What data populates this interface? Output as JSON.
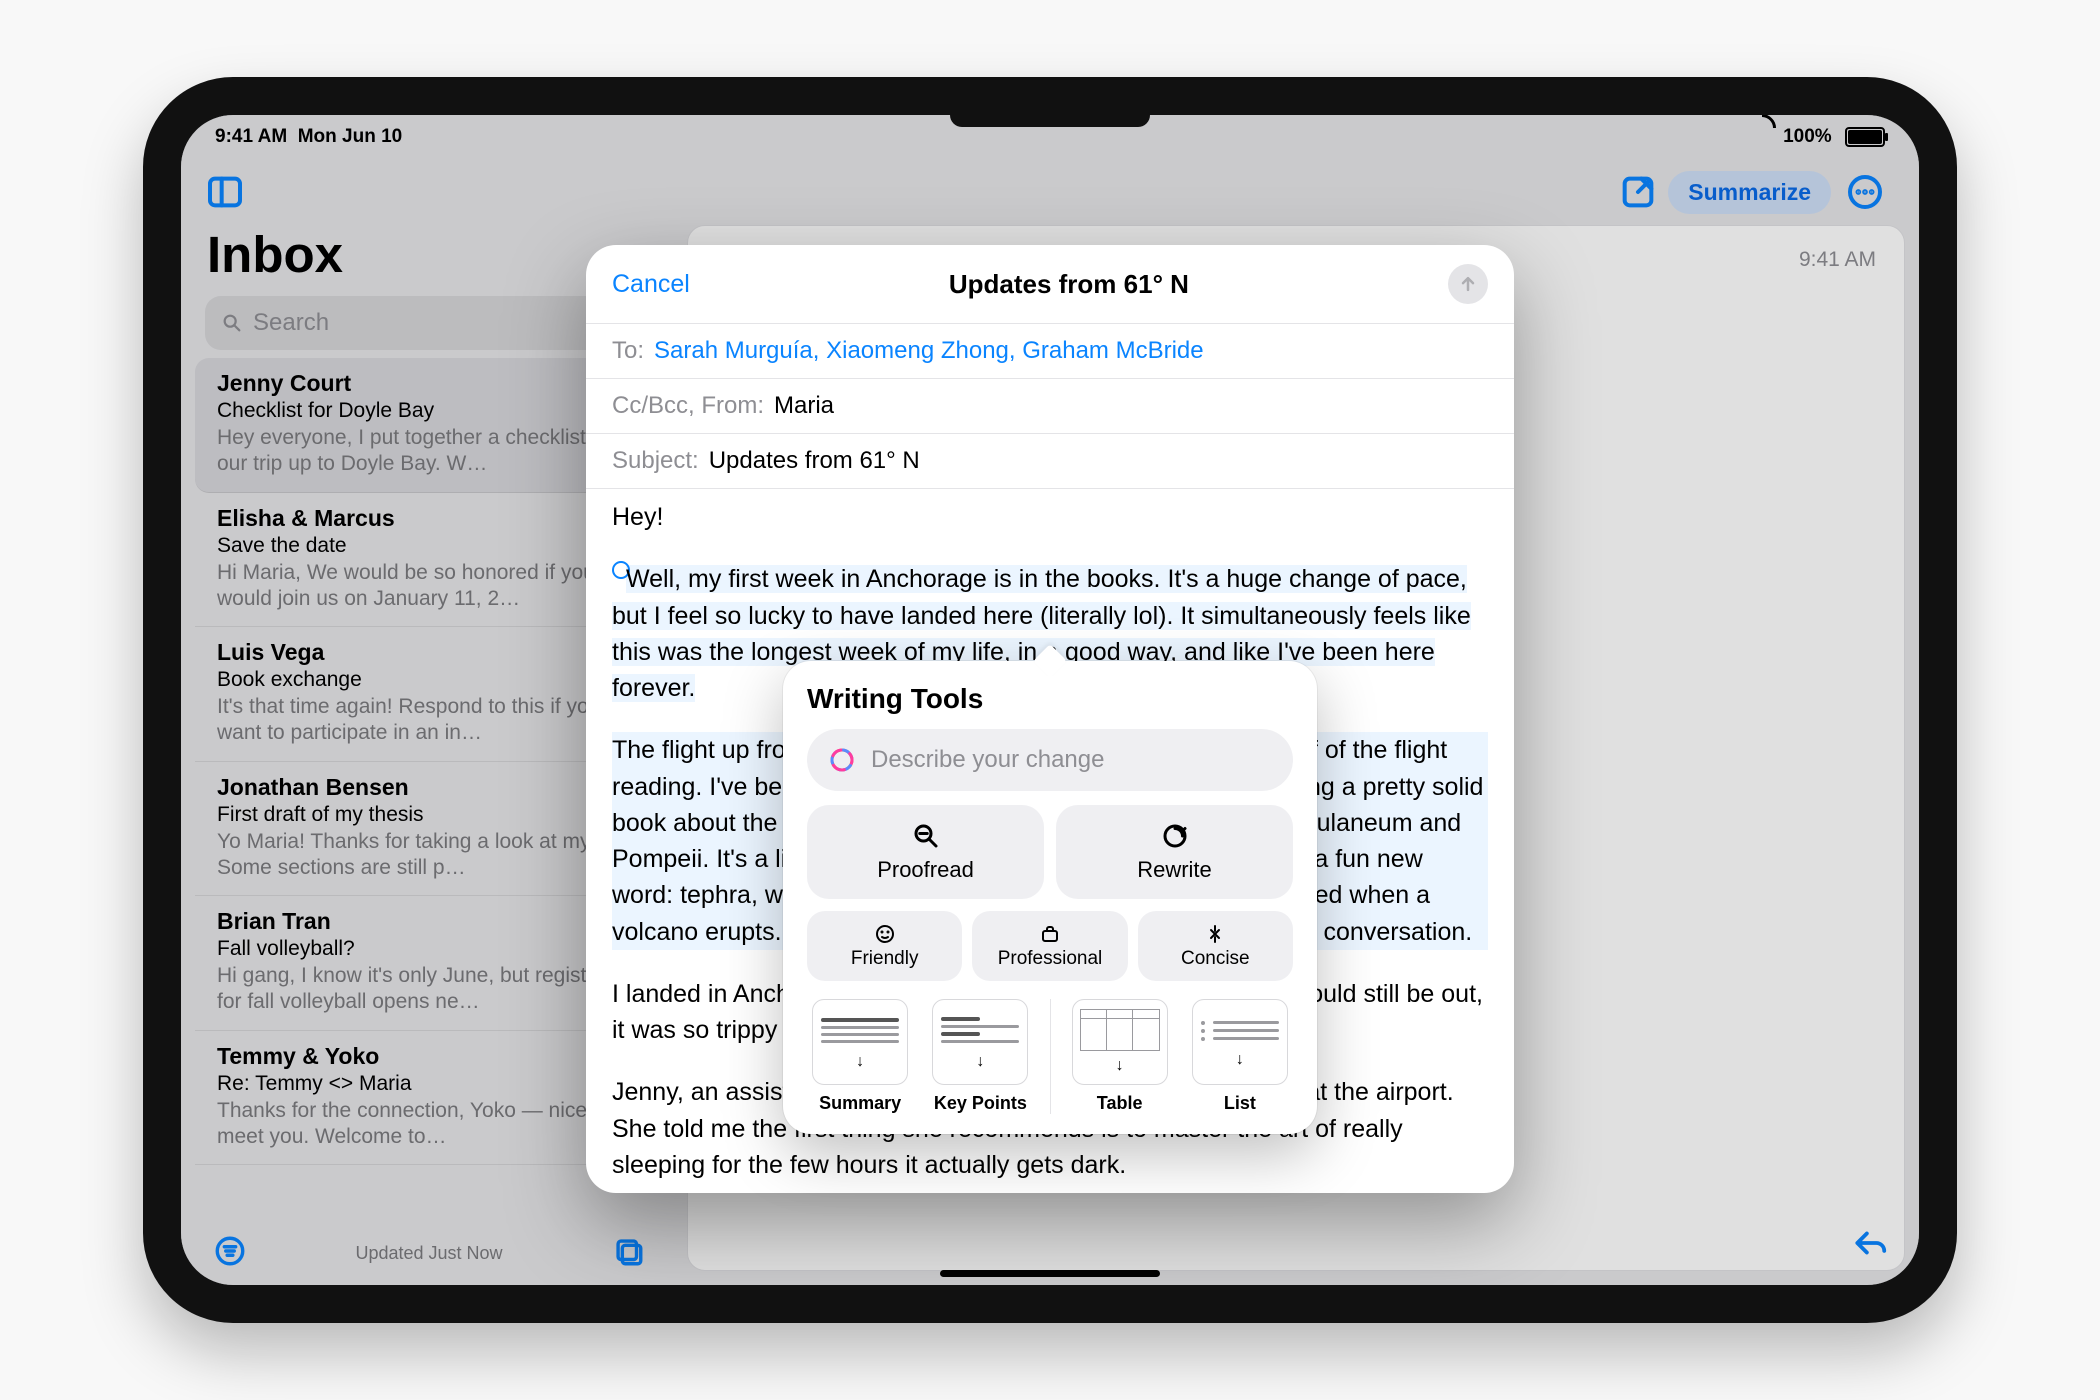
{
  "status": {
    "time": "9:41 AM",
    "date": "Mon Jun 10",
    "battery": "100%"
  },
  "toolbar": {
    "summarize": "Summarize"
  },
  "sidebar": {
    "title": "Inbox",
    "search_placeholder": "Search",
    "updated": "Updated Just Now",
    "items": [
      {
        "name": "Jenny Court",
        "subject": "Checklist for Doyle Bay",
        "preview": "Hey everyone, I put together a checklist for our trip up to Doyle Bay. W…"
      },
      {
        "name": "Elisha & Marcus",
        "subject": "Save the date",
        "preview": "Hi Maria, We would be so honored if you would join us on January 11, 2…"
      },
      {
        "name": "Luis Vega",
        "subject": "Book exchange",
        "preview": "It's that time again! Respond to this if you want to participate in an in…"
      },
      {
        "name": "Jonathan Bensen",
        "subject": "First draft of my thesis",
        "preview": "Yo Maria! Thanks for taking a look at my draft. Some sections are still p…"
      },
      {
        "name": "Brian Tran",
        "subject": "Fall volleyball?",
        "preview": "Hi gang, I know it's only June, but registration for fall volleyball opens ne…"
      },
      {
        "name": "Temmy & Yoko",
        "subject": "Re: Temmy <> Maria",
        "preview": "Thanks for the connection, Yoko — nice to meet you. Welcome to…"
      }
    ]
  },
  "content": {
    "time": "9:41 AM"
  },
  "compose": {
    "cancel": "Cancel",
    "title": "Updates from 61° N",
    "to_label": "To:",
    "recipients": "Sarah Murguía, Xiaomeng Zhong, Graham McBride",
    "ccbcc_label": "Cc/Bcc, From:",
    "from": "Maria",
    "subject_label": "Subject:",
    "subject": "Updates from 61° N",
    "body": {
      "p1": "Hey!",
      "p2": "Well, my first week in Anchorage is in the books. It's a huge change of pace, but I feel so lucky to have landed here (literally lol). It simultaneously feels like this was the longest week of my life, in a good way, and like I've been here forever.",
      "p3": "The flight up from Seattle was beautiful, and I spent the first half of the flight reading. I've been on a history kick lately, and just started reading a pretty solid book about the eruption of Vesuvius and the destruction of Herculaneum and Pompeii. It's a little dry at points but pretty interesting. I learned a fun new word: tephra, which is what we call most of the stuff that is ejected when a volcano erupts. Let me know if you find a way to bring that up in conversation.",
      "p4": "I landed in Anchorage around 11pm, and I forgot that the sun would still be out, it was so trippy to see.",
      "p5": "Jenny, an assistant professor in the department, picked me up at the airport. She told me the first thing she recommends is to master the art of really sleeping for the few hours it actually gets dark."
    }
  },
  "wt": {
    "title": "Writing Tools",
    "placeholder": "Describe your change",
    "proofread": "Proofread",
    "rewrite": "Rewrite",
    "friendly": "Friendly",
    "professional": "Professional",
    "concise": "Concise",
    "summary": "Summary",
    "keypoints": "Key Points",
    "table": "Table",
    "list": "List"
  }
}
